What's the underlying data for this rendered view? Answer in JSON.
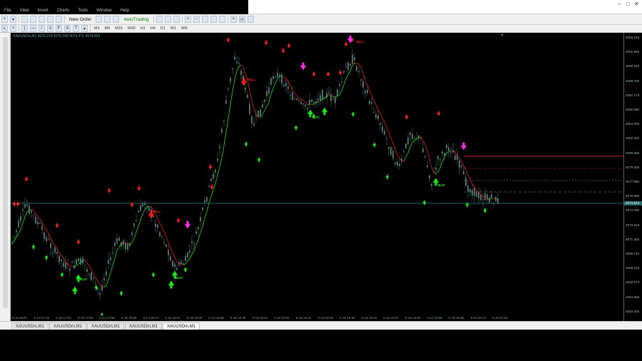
{
  "menu": [
    "File",
    "View",
    "Insert",
    "Charts",
    "Tools",
    "Window",
    "Help"
  ],
  "window_controls": [
    "–",
    "□",
    "✕"
  ],
  "toolbar": {
    "new_order": "New Order",
    "auto_trading": "AutoTrading"
  },
  "timeframes": [
    "M1",
    "M5",
    "M15",
    "M30",
    "H1",
    "H4",
    "D1",
    "W1",
    "MN"
  ],
  "chart": {
    "header": "XAUUSDm,M1  4075.218 4075.340 4074.471 4074.824",
    "symbol": "XAUUSDm,M1",
    "current_price_label": "4074.824",
    "price_ticks": [
      "4093.515",
      "4091.930",
      "4090.345",
      "4088.760",
      "4087.175",
      "4085.590",
      "4084.005",
      "4082.420",
      "4080.835",
      "4079.250",
      "4077.665",
      "4076.080",
      "4074.495",
      "4072.910",
      "4071.325",
      "4069.740",
      "4068.155",
      "4066.570",
      "4064.985",
      "4063.400"
    ],
    "time_ticks": [
      "8 Jul 2025",
      "8 Jul 17:34",
      "8 Jul 17:42",
      "8 Jul 17:50",
      "8 Jul 17:58",
      "8 Jul 18:06",
      "8 Jul 18:14",
      "8 Jul 18:22",
      "8 Jul 18:30",
      "8 Jul 18:38",
      "8 Jul 18:46",
      "8 Jul 18:54",
      "8 Jul 19:02",
      "8 Jul 19:10",
      "8 Jul 19:18",
      "8 Jul 19:26",
      "8 Jul 19:34",
      "8 Jul 19:42",
      "8 Jul 19:50",
      "8 Jul 19:58",
      "8 Jul 20:06",
      "8 Jul 20:14",
      "8 Jul 20:22"
    ],
    "signal_labels": {
      "sell": "SELL",
      "buy": "BUY"
    },
    "colors": {
      "background": "#000000",
      "candle": "#4f6f6f",
      "ma_up": "#16c816",
      "ma_down": "#c81e1e",
      "arrow_sell": "#ff1e1e",
      "arrow_buy": "#18e818",
      "arrow_big_sell": "#ff2fe6",
      "level_line": "#2a8a8a"
    }
  },
  "tabs": [
    "XAUUSDm,M1",
    "XAUUSDm,M1",
    "XAUUSDm,M1",
    "XAUUSDm,M1",
    "XAUUSDm,M1"
  ],
  "active_tab": 4
}
